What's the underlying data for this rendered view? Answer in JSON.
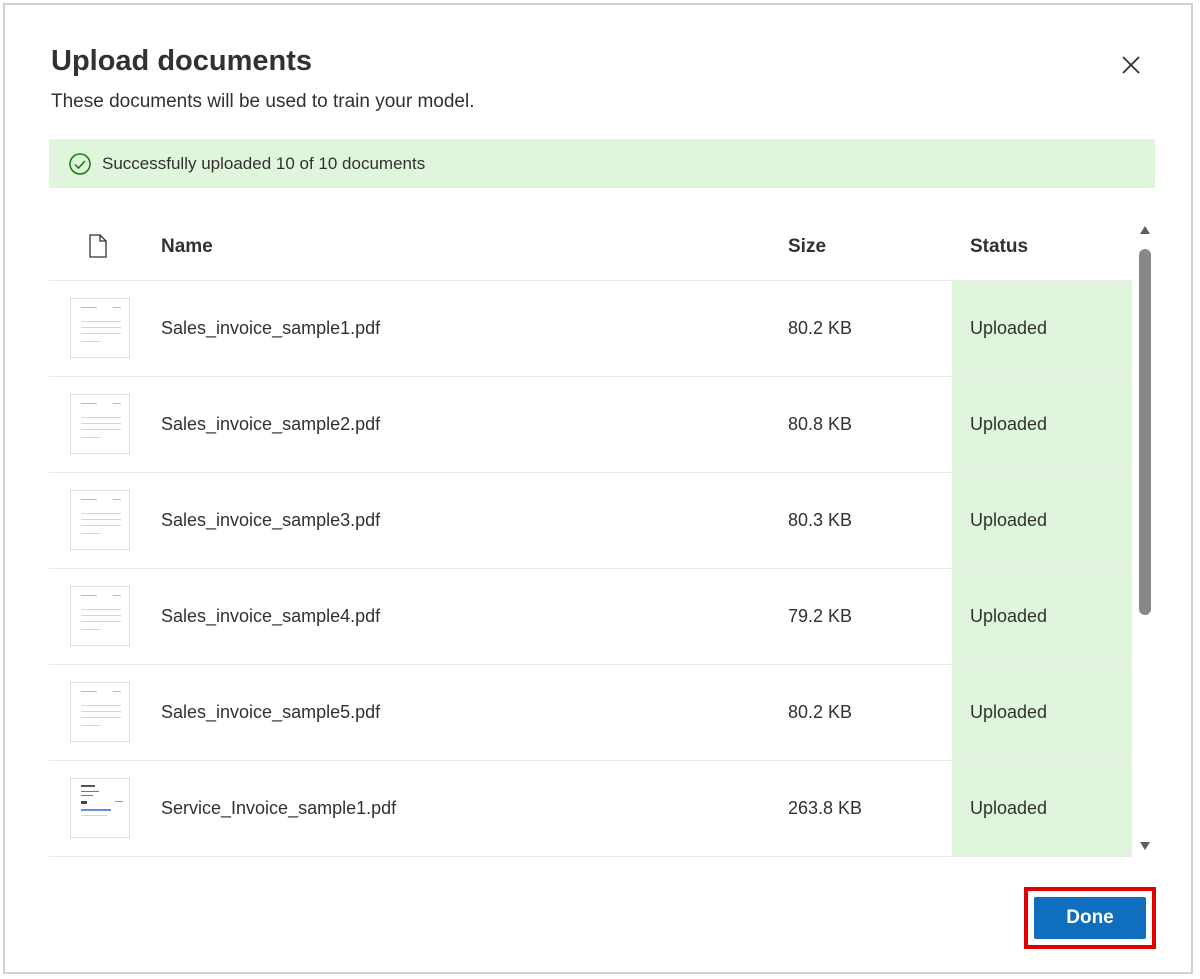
{
  "dialog": {
    "title": "Upload documents",
    "subtitle": "These documents will be used to train your model.",
    "close_icon": "close-icon"
  },
  "banner": {
    "icon": "check-circle-icon",
    "message": "Successfully uploaded 10 of 10 documents",
    "background": "#dff6dd"
  },
  "table": {
    "headers": {
      "icon": "document-icon",
      "name": "Name",
      "size": "Size",
      "status": "Status"
    },
    "rows": [
      {
        "name": "Sales_invoice_sample1.pdf",
        "size": "80.2 KB",
        "status": "Uploaded"
      },
      {
        "name": "Sales_invoice_sample2.pdf",
        "size": "80.8 KB",
        "status": "Uploaded"
      },
      {
        "name": "Sales_invoice_sample3.pdf",
        "size": "80.3 KB",
        "status": "Uploaded"
      },
      {
        "name": "Sales_invoice_sample4.pdf",
        "size": "79.2 KB",
        "status": "Uploaded"
      },
      {
        "name": "Sales_invoice_sample5.pdf",
        "size": "80.2 KB",
        "status": "Uploaded"
      },
      {
        "name": "Service_Invoice_sample1.pdf",
        "size": "263.8 KB",
        "status": "Uploaded"
      }
    ]
  },
  "footer": {
    "done_label": "Done"
  },
  "colors": {
    "accent": "#106ebe",
    "highlight": "#e00000",
    "success_bg": "#dff6dd",
    "success_icon": "#107c10"
  }
}
